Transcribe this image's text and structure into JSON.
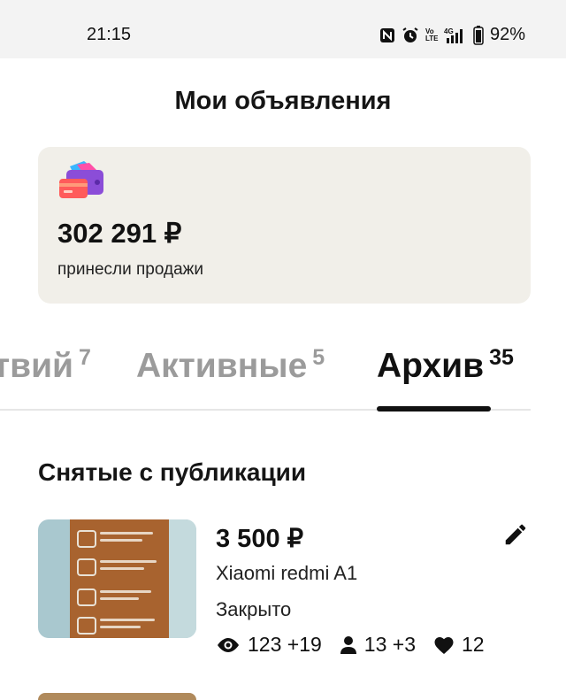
{
  "status_bar": {
    "time": "21:15",
    "icons": [
      "nfc-icon",
      "alarm-icon",
      "volte-icon",
      "4g-signal-icon",
      "battery-icon"
    ],
    "volte_text": "Vo LTE",
    "network_text": "4G",
    "battery": "92%"
  },
  "header": {
    "title": "Мои объявления"
  },
  "sales_card": {
    "icon": "wallet-cards-icon",
    "amount": "302 291 ₽",
    "label": "принесли продажи"
  },
  "tabs": [
    {
      "label": "твий",
      "count": "7",
      "selected": false
    },
    {
      "label": "Активные",
      "count": "5",
      "selected": false
    },
    {
      "label": "Архив",
      "count": "35",
      "selected": true
    }
  ],
  "section": {
    "title": "Снятые с публикации"
  },
  "listings": [
    {
      "price": "3 500 ₽",
      "title": "Xiaomi redmi A1",
      "status": "Закрыто",
      "views": "123",
      "views_delta": "+19",
      "contacts": "13",
      "contacts_delta": "+3",
      "favorites": "12"
    }
  ],
  "colors": {
    "accent": "#111111",
    "inactive_tab": "#9b9b9b",
    "card_bg": "#f1efe9"
  }
}
